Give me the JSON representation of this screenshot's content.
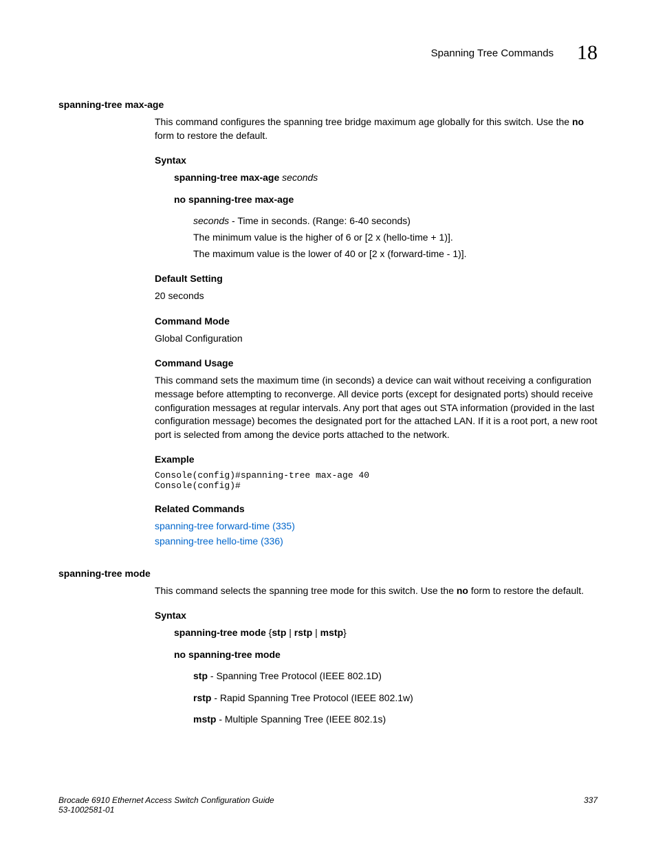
{
  "header": {
    "section": "Spanning Tree Commands",
    "chapter": "18"
  },
  "cmd1": {
    "name": "spanning-tree max-age",
    "desc1": "This command configures the spanning tree bridge maximum age globally for this switch. Use the ",
    "desc_bold": "no",
    "desc2": " form to restore the default.",
    "syntax_head": "Syntax",
    "syntax_line1_bold": "spanning-tree max-age",
    "syntax_line1_italic": " seconds",
    "syntax_line2": "no spanning-tree max-age",
    "param_italic": "seconds",
    "param_text": " - Time in seconds. (Range: 6-40 seconds)",
    "param_line2": "The minimum value is the higher of 6 or [2 x (hello-time + 1)].",
    "param_line3": "The maximum value is the lower of 40 or [2 x (forward-time - 1)].",
    "default_head": "Default Setting",
    "default_text": "20 seconds",
    "mode_head": "Command Mode",
    "mode_text": "Global Configuration",
    "usage_head": "Command Usage",
    "usage_text": "This command sets the maximum time (in seconds) a device can wait without receiving a configuration message before attempting to reconverge. All device ports (except for designated ports) should receive configuration messages at regular intervals. Any port that ages out STA information (provided in the last configuration message) becomes the designated port for the attached LAN. If it is a root port, a new root port is selected from among the device ports attached to the network.",
    "example_head": "Example",
    "example_code": "Console(config)#spanning-tree max-age 40\nConsole(config)#",
    "related_head": "Related Commands",
    "related_link1": "spanning-tree forward-time (335)",
    "related_link2": "spanning-tree hello-time (336)"
  },
  "cmd2": {
    "name": "spanning-tree mode",
    "desc1": "This command selects the spanning tree mode for this switch. Use the ",
    "desc_bold": "no",
    "desc2": " form to restore the default.",
    "syntax_head": "Syntax",
    "syntax_line1_a": "spanning-tree mode",
    "syntax_line1_b": " {",
    "syntax_line1_c": "stp",
    "syntax_line1_d": " | ",
    "syntax_line1_e": "rstp",
    "syntax_line1_f": " | ",
    "syntax_line1_g": "mstp",
    "syntax_line1_h": "}",
    "syntax_line2": "no spanning-tree mode",
    "opt1_bold": "stp",
    "opt1_text": " - Spanning Tree Protocol (IEEE 802.1D)",
    "opt2_bold": "rstp",
    "opt2_text": " - Rapid Spanning Tree Protocol (IEEE 802.1w)",
    "opt3_bold": "mstp",
    "opt3_text": " - Multiple Spanning Tree (IEEE 802.1s)"
  },
  "footer": {
    "line1": "Brocade 6910 Ethernet Access Switch Configuration Guide",
    "line2": "53-1002581-01",
    "page": "337"
  }
}
